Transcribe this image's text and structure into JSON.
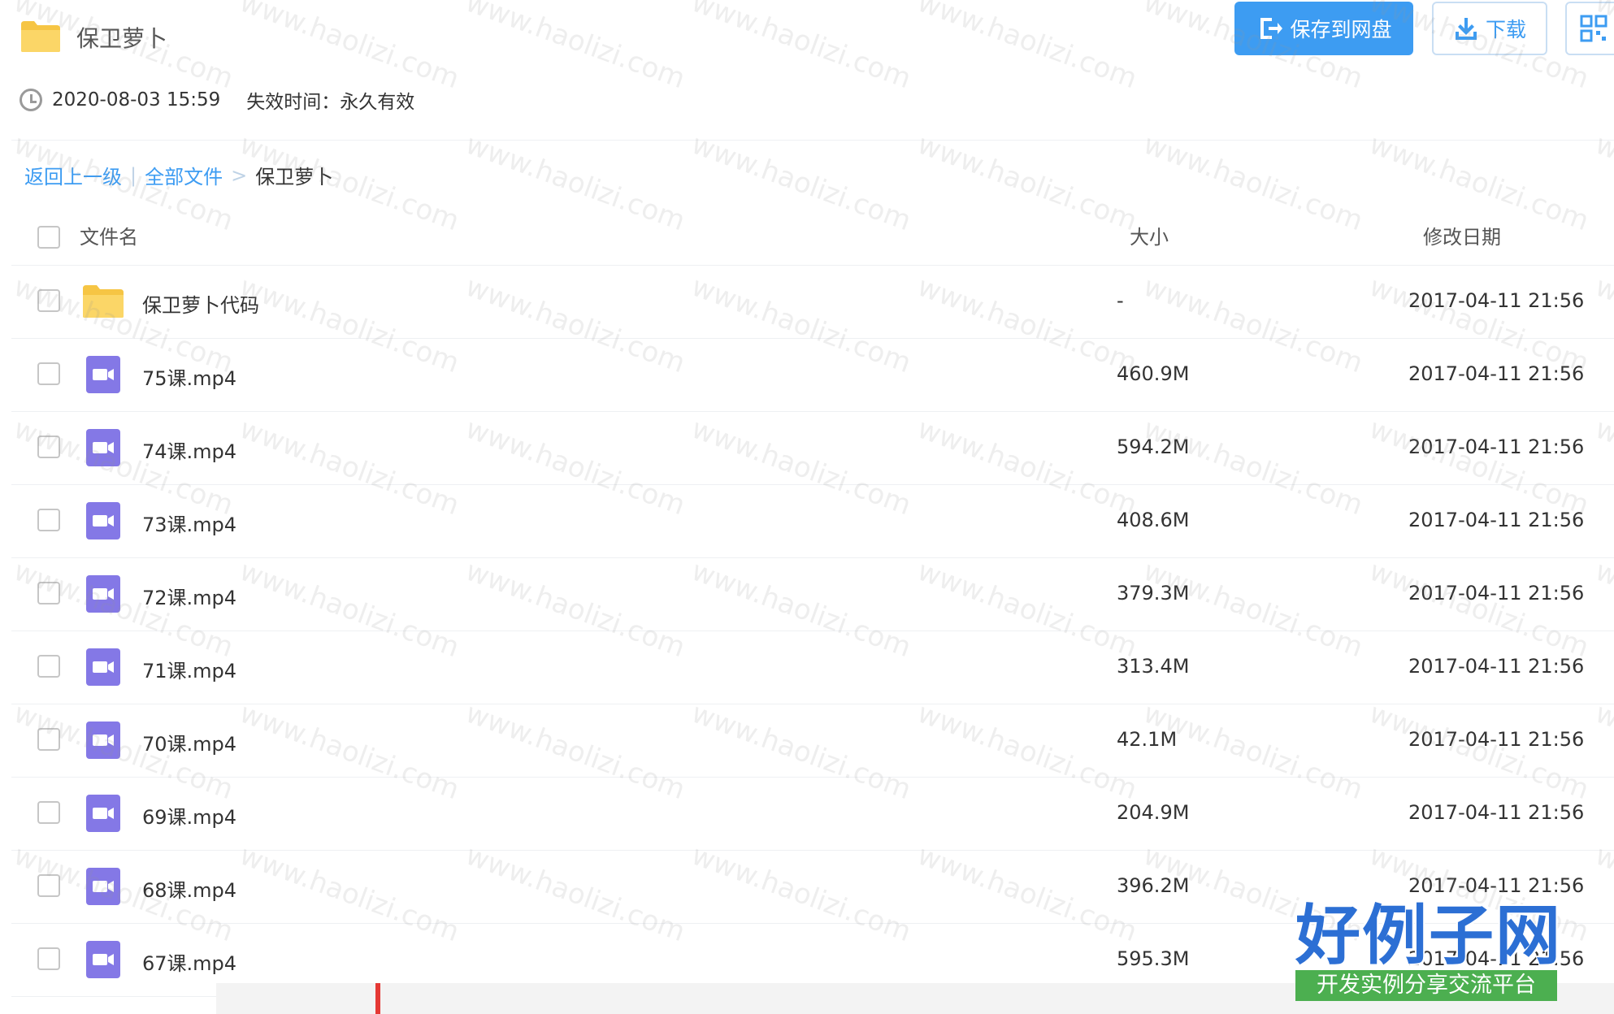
{
  "header": {
    "folder_title": "保卫萝卜",
    "share_time": "2020-08-03 15:59",
    "expire_text": "失效时间：永久有效",
    "save_button": "保存到网盘",
    "download_button": "下载"
  },
  "breadcrumb": {
    "back": "返回上一级",
    "sep1": "|",
    "all_files": "全部文件",
    "sep2": ">",
    "current": "保卫萝卜"
  },
  "table": {
    "columns": {
      "name": "文件名",
      "size": "大小",
      "date": "修改日期"
    },
    "rows": [
      {
        "name": "保卫萝卜代码",
        "size": "-",
        "date": "2017-04-11 21:56",
        "type": "folder"
      },
      {
        "name": "75课.mp4",
        "size": "460.9M",
        "date": "2017-04-11 21:56",
        "type": "video"
      },
      {
        "name": "74课.mp4",
        "size": "594.2M",
        "date": "2017-04-11 21:56",
        "type": "video"
      },
      {
        "name": "73课.mp4",
        "size": "408.6M",
        "date": "2017-04-11 21:56",
        "type": "video"
      },
      {
        "name": "72课.mp4",
        "size": "379.3M",
        "date": "2017-04-11 21:56",
        "type": "video"
      },
      {
        "name": "71课.mp4",
        "size": "313.4M",
        "date": "2017-04-11 21:56",
        "type": "video"
      },
      {
        "name": "70课.mp4",
        "size": "42.1M",
        "date": "2017-04-11 21:56",
        "type": "video"
      },
      {
        "name": "69课.mp4",
        "size": "204.9M",
        "date": "2017-04-11 21:56",
        "type": "video"
      },
      {
        "name": "68课.mp4",
        "size": "396.2M",
        "date": "2017-04-11 21:56",
        "type": "video"
      },
      {
        "name": "67课.mp4",
        "size": "595.3M",
        "date": "2017-04-11 21:56",
        "type": "video"
      }
    ]
  },
  "watermark": "www.haolizi.com",
  "logo": {
    "main": "好例子网",
    "sub": "开发实例分享交流平台"
  },
  "colors": {
    "accent": "#3d9cf2",
    "folder": "#f8cd55",
    "video": "#8478e6",
    "logo_green": "#4caf50"
  }
}
